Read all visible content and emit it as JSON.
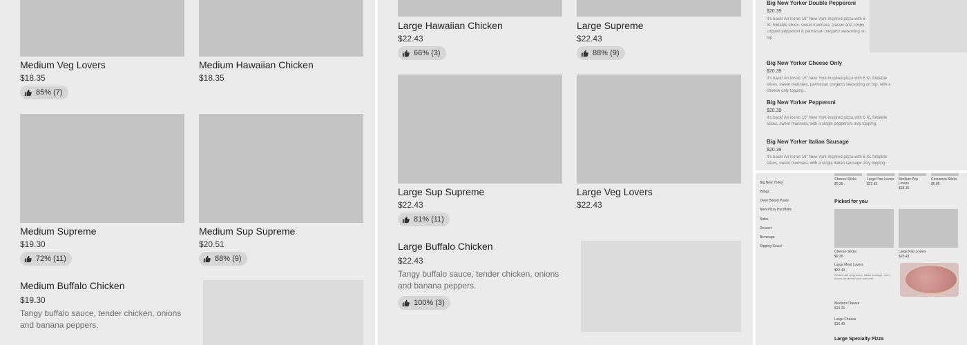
{
  "panel_a": {
    "items": [
      {
        "name": "Medium Veg Lovers",
        "price": "$18.35",
        "rating": "85% (7)"
      },
      {
        "name": "Medium Hawaiian Chicken",
        "price": "$18.35"
      },
      {
        "name": "Medium Supreme",
        "price": "$19.30",
        "rating": "72% (11)"
      },
      {
        "name": "Medium Sup Supreme",
        "price": "$20.51",
        "rating": "88% (9)"
      },
      {
        "name": "Medium Buffalo Chicken",
        "price": "$19.30",
        "description": "Tangy buffalo sauce, tender chicken, onions and banana peppers."
      }
    ]
  },
  "panel_b": {
    "items": [
      {
        "name": "Large Hawaiian Chicken",
        "price": "$22.43",
        "rating": "66% (3)"
      },
      {
        "name": "Large Supreme",
        "price": "$22.43",
        "rating": "88% (9)"
      },
      {
        "name": "Large Sup Supreme",
        "price": "$22.43",
        "rating": "81% (11)"
      },
      {
        "name": "Large Veg Lovers",
        "price": "$22.43"
      },
      {
        "name": "Large Buffalo Chicken",
        "price": "$22.43",
        "description": "Tangy buffalo sauce, tender chicken, onions and banana peppers.",
        "rating": "100% (3)"
      }
    ]
  },
  "panel_c": {
    "items": [
      {
        "name": "Big New Yorker Double Pepperoni",
        "price": "$20.39",
        "description": "It's back! An iconic 16\" New York-inspired pizza with 6 XL foldable slices, sweet marinara, classic and crispy cupped pepperoni & parmesan oregano seasoning on top."
      },
      {
        "name": "Big New Yorker Cheese Only",
        "price": "$20.39",
        "description": "It's back! An iconic 16\" New York-inspired pizza with 6 XL foldable slices, sweet marinara, parmesan oregano seasoning on top, with a cheese only topping."
      },
      {
        "name": "Big New Yorker Pepperoni",
        "price": "$20.39",
        "description": "It's back! An iconic 16\" New York-inspired pizza with 6 XL foldable slices, sweet marinara, with a single pepperoni only topping."
      },
      {
        "name": "Big New Yorker Italian Sausage",
        "price": "$20.39",
        "description": "It's back! An iconic 16\" New York-inspired pizza with 6 XL foldable slices, sweet marinara, with a single italian sausage only topping."
      }
    ]
  },
  "panel_d": {
    "nav": [
      "Big New Yorker",
      "Wings",
      "Oven Baked Pasta",
      "New Pizza Hut Melts",
      "Sides",
      "Dessert",
      "Beverage",
      "Dipping Sauce"
    ],
    "top_row": [
      {
        "name": "Cheese Sticks",
        "price": "$9.35"
      },
      {
        "name": "Large Pep Lovers",
        "price": "$22.43"
      },
      {
        "name": "Medium Pep Lovers",
        "price": "$18.35"
      },
      {
        "name": "Cinnamon Sticks",
        "price": "$6.86"
      }
    ],
    "picked_heading": "Picked for you",
    "picked": [
      {
        "name": "Cheese Sticks",
        "price": "$9.35"
      },
      {
        "name": "Large Pep Lovers",
        "price": "$22.43"
      }
    ],
    "large_meat": {
      "name": "Large Meat Lovers",
      "price": "$22.43",
      "description": "Packed with pepperoni, Italian sausage, ham, bacon, seasoned pork and beef."
    },
    "list": [
      {
        "name": "Medium Cheese",
        "price": "$13.31"
      },
      {
        "name": "Large Cheese",
        "price": "$16.42"
      }
    ],
    "section_heading": "Large Specialty Pizza"
  }
}
